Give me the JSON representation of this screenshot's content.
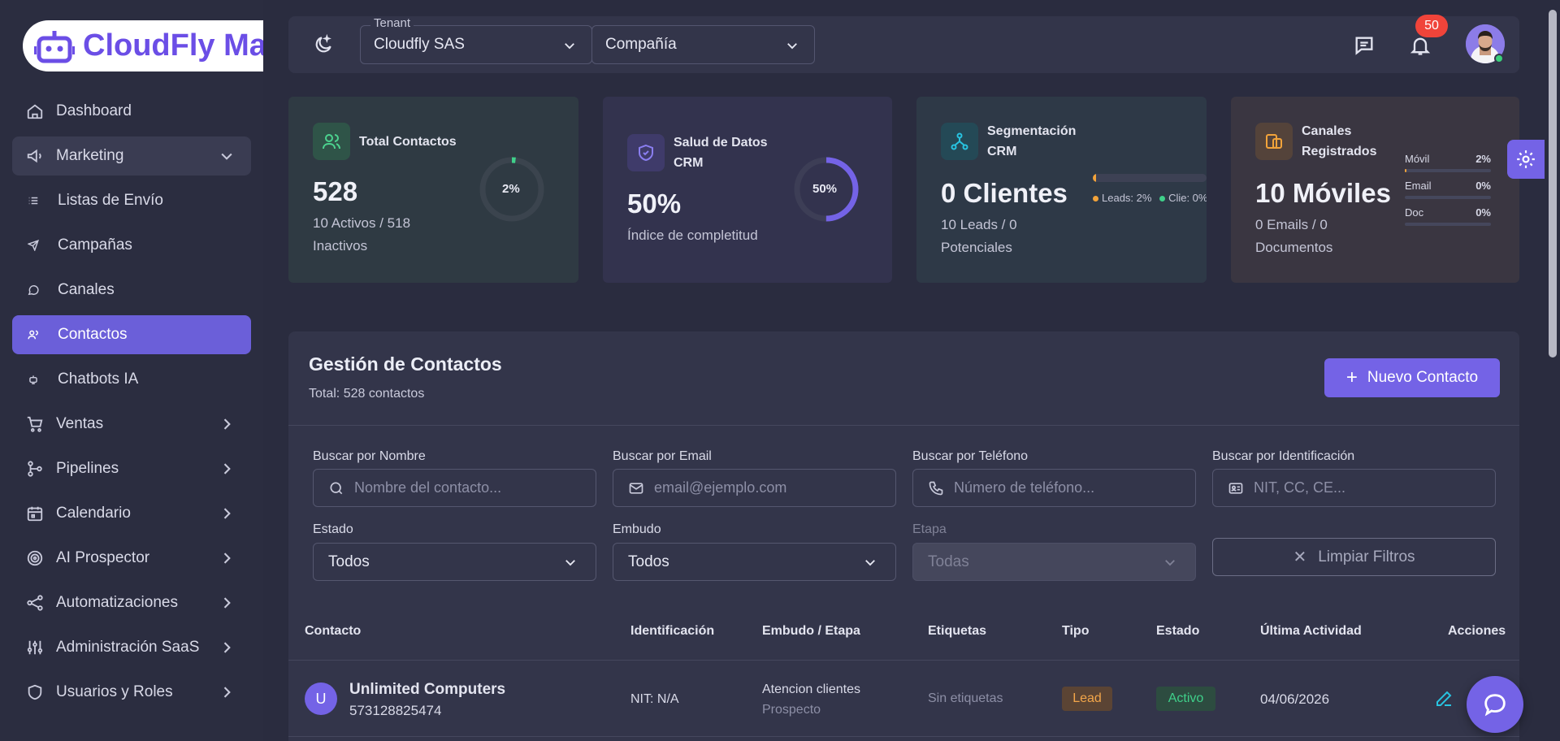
{
  "brand": {
    "name": "CloudFly Ma"
  },
  "sidebar": {
    "items": [
      {
        "label": "Dashboard",
        "icon": "home-icon"
      },
      {
        "label": "Marketing",
        "icon": "megaphone-icon",
        "expanded": true
      },
      {
        "label": "Listas de Envío",
        "icon": "list-icon",
        "sub": true
      },
      {
        "label": "Campañas",
        "icon": "send-icon",
        "sub": true
      },
      {
        "label": "Canales",
        "icon": "whatsapp-icon",
        "sub": true
      },
      {
        "label": "Contactos",
        "icon": "users-icon",
        "sub": true,
        "active": true
      },
      {
        "label": "Chatbots IA",
        "icon": "bot-icon",
        "sub": true
      },
      {
        "label": "Ventas",
        "icon": "cart-icon"
      },
      {
        "label": "Pipelines",
        "icon": "branch-icon"
      },
      {
        "label": "Calendario",
        "icon": "calendar-icon"
      },
      {
        "label": "AI Prospector",
        "icon": "target-icon"
      },
      {
        "label": "Automatizaciones",
        "icon": "share-icon"
      },
      {
        "label": "Administración SaaS",
        "icon": "sliders-icon"
      },
      {
        "label": "Usuarios y Roles",
        "icon": "shield-icon"
      }
    ]
  },
  "topbar": {
    "tenant_legend": "Tenant",
    "tenant_value": "Cloudfly SAS",
    "company_value": "Compañía",
    "notifications_count": "50"
  },
  "stats": {
    "contacts": {
      "title": "Total Contactos",
      "value": "528",
      "sub": "10 Activos / 518 Inactivos",
      "ring_label": "2%",
      "percent": 2
    },
    "health": {
      "title": "Salud de Datos CRM",
      "value": "50%",
      "sub": "Índice de completitud",
      "ring_label": "50%",
      "percent": 50
    },
    "segment": {
      "title": "Segmentación CRM",
      "value": "0 Clientes",
      "sub": "10 Leads / 0 Potenciales",
      "legend_leads": "Leads: 2%",
      "legend_clients": "Clie: 0%",
      "leads_percent": 2
    },
    "channels": {
      "title": "Canales Registrados",
      "value": "10 Móviles",
      "sub": "0 Emails / 0 Documentos",
      "rows": [
        {
          "name": "Móvil",
          "value": "2%",
          "percent": 2
        },
        {
          "name": "Email",
          "value": "0%",
          "percent": 0
        },
        {
          "name": "Doc",
          "value": "0%",
          "percent": 0
        }
      ]
    }
  },
  "panel": {
    "title": "Gestión de Contactos",
    "subtitle": "Total: 528 contactos",
    "new_button": "Nuevo Contacto",
    "filters": {
      "name_label": "Buscar por Nombre",
      "name_placeholder": "Nombre del contacto...",
      "email_label": "Buscar por Email",
      "email_placeholder": "email@ejemplo.com",
      "phone_label": "Buscar por Teléfono",
      "phone_placeholder": "Número de teléfono...",
      "id_label": "Buscar por Identificación",
      "id_placeholder": "NIT, CC, CE...",
      "status_label": "Estado",
      "status_value": "Todos",
      "funnel_label": "Embudo",
      "funnel_value": "Todos",
      "stage_label": "Etapa",
      "stage_value": "Todas",
      "clear_button": "Limpiar Filtros"
    },
    "columns": [
      "Contacto",
      "Identificación",
      "Embudo / Etapa",
      "Etiquetas",
      "Tipo",
      "Estado",
      "Última Actividad",
      "Acciones"
    ],
    "rows": [
      {
        "initial": "U",
        "name": "Unlimited Computers",
        "phone": "573128825474",
        "identification": "NIT: N/A",
        "funnel": "Atencion clientes",
        "stage": "Prospecto",
        "tags": "Sin etiquetas",
        "type": "Lead",
        "status": "Activo",
        "last_activity": "04/06/2026"
      }
    ]
  }
}
